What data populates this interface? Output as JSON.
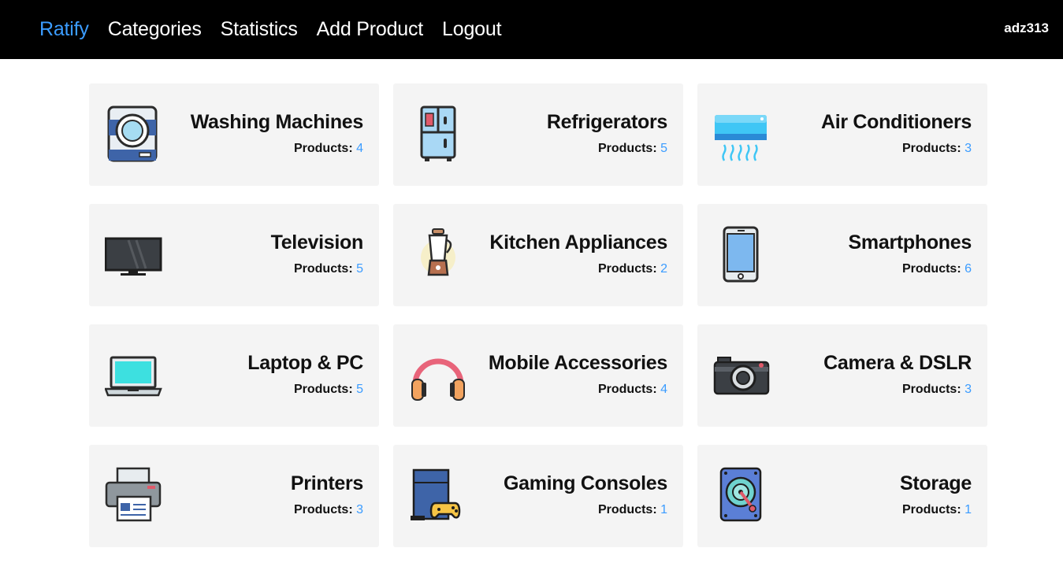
{
  "nav": {
    "brand": "Ratify",
    "links": [
      "Categories",
      "Statistics",
      "Add Product",
      "Logout"
    ],
    "user": "adz313"
  },
  "products_label": "Products:",
  "categories": [
    {
      "name": "Washing Machines",
      "count": "4",
      "icon": "washing-machine-icon"
    },
    {
      "name": "Refrigerators",
      "count": "5",
      "icon": "refrigerator-icon"
    },
    {
      "name": "Air Conditioners",
      "count": "3",
      "icon": "air-conditioner-icon"
    },
    {
      "name": "Television",
      "count": "5",
      "icon": "television-icon"
    },
    {
      "name": "Kitchen Appliances",
      "count": "2",
      "icon": "blender-icon"
    },
    {
      "name": "Smartphones",
      "count": "6",
      "icon": "smartphone-icon"
    },
    {
      "name": "Laptop & PC",
      "count": "5",
      "icon": "laptop-icon"
    },
    {
      "name": "Mobile Accessories",
      "count": "4",
      "icon": "headphones-icon"
    },
    {
      "name": "Camera & DSLR",
      "count": "3",
      "icon": "camera-icon"
    },
    {
      "name": "Printers",
      "count": "3",
      "icon": "printer-icon"
    },
    {
      "name": "Gaming Consoles",
      "count": "1",
      "icon": "gaming-console-icon"
    },
    {
      "name": "Storage",
      "count": "1",
      "icon": "hard-disk-icon"
    }
  ]
}
